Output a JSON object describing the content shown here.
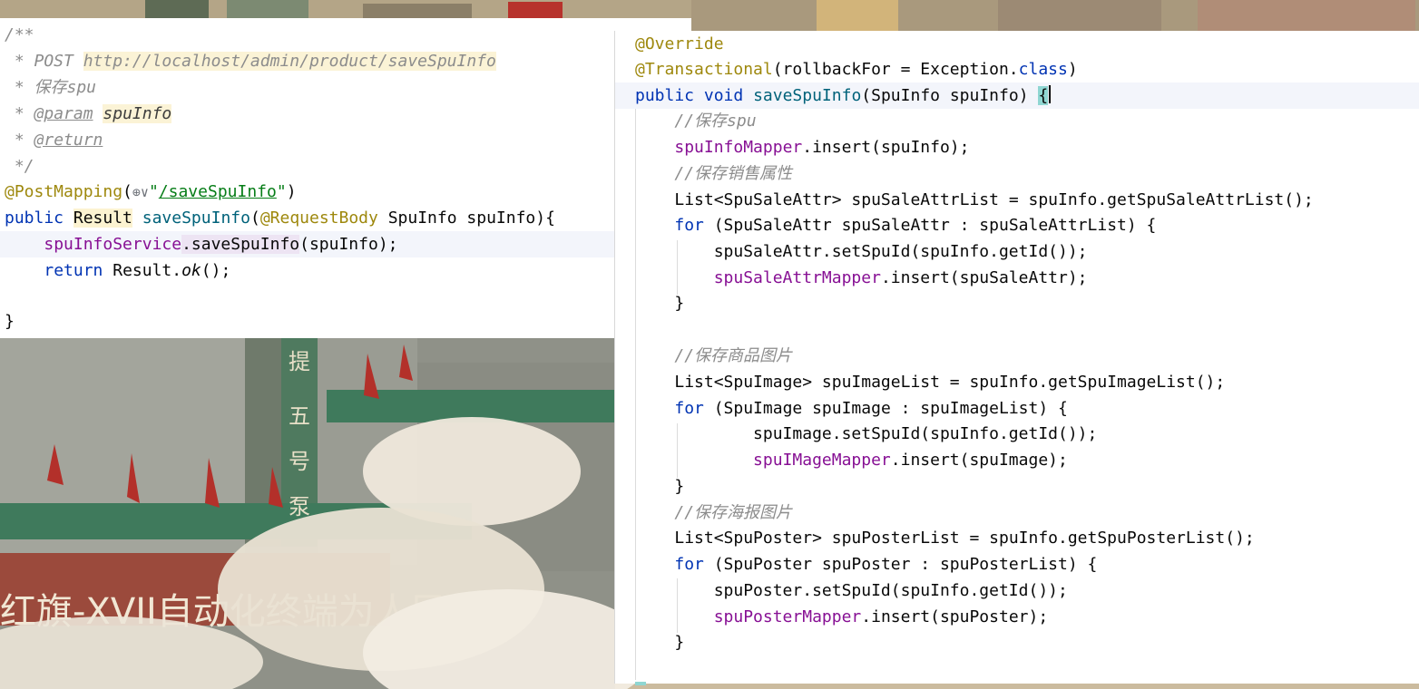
{
  "left_code": {
    "l1": "/**",
    "l2_prefix": " * POST ",
    "l2_url": "http://localhost/admin/product/saveSpuInfo",
    "l3": " * 保存spu",
    "l4_prefix": " * ",
    "l4_tag": "@param",
    "l4_name": "spuInfo",
    "l5_prefix": " * ",
    "l5_tag": "@return",
    "l6": " */",
    "l7_ann": "@PostMapping",
    "l7_open": "(",
    "l7_icon": "⊕∨",
    "l7_q1": "\"",
    "l7_path": "/saveSpuInfo",
    "l7_q2": "\"",
    "l7_close": ")",
    "l8_kw": "public",
    "l8_type": "Result",
    "l8_fn": "saveSpuInfo",
    "l8_open": "(",
    "l8_ann": "@RequestBody",
    "l8_rest": " SpuInfo spuInfo){",
    "l9_field": "spuInfoService",
    "l9_call": ".saveSpuInfo",
    "l9_rest": "(spuInfo);",
    "l10_kw": "return",
    "l10_cls": " Result.",
    "l10_fn": "ok",
    "l10_rest": "();",
    "l12": "}"
  },
  "right_code": {
    "r1": "@Override",
    "r2_ann": "@Transactional",
    "r2_rest": "(rollbackFor = Exception.",
    "r2_kw": "class",
    "r2_end": ")",
    "r3_kw1": "public",
    "r3_kw2": "void",
    "r3_fn": "saveSpuInfo",
    "r3_rest": "(SpuInfo spuInfo) ",
    "r3_brace": "{",
    "r4": "//保存spu",
    "r5_field": "spuInfoMapper",
    "r5_rest": ".insert(spuInfo);",
    "r6": "//保存销售属性",
    "r7": "List<SpuSaleAttr> spuSaleAttrList = spuInfo.getSpuSaleAttrList();",
    "r8_kw": "for",
    "r8_rest": " (SpuSaleAttr spuSaleAttr : spuSaleAttrList) {",
    "r9": "spuSaleAttr.setSpuId(spuInfo.getId());",
    "r10_field": "spuSaleAttrMapper",
    "r10_rest": ".insert(spuSaleAttr);",
    "r11": "}",
    "r13": "//保存商品图片",
    "r14": "List<SpuImage> spuImageList = spuInfo.getSpuImageList();",
    "r15_kw": "for",
    "r15_rest": " (SpuImage spuImage : spuImageList) {",
    "r16": "spuImage.setSpuId(spuInfo.getId());",
    "r17_field": "spuIMageMapper",
    "r17_rest": ".insert(spuImage);",
    "r18": "}",
    "r19": "//保存海报图片",
    "r20": "List<SpuPoster> spuPosterList = spuInfo.getSpuPosterList();",
    "r21_kw": "for",
    "r21_rest": " (SpuPoster spuPoster : spuPosterList) {",
    "r22": "spuPoster.setSpuId(spuInfo.getId());",
    "r23_field": "spuPosterMapper",
    "r23_rest": ".insert(spuPoster);",
    "r24": "}"
  },
  "wallpaper": {
    "vertical_text": [
      "提",
      "五",
      "号",
      "泵"
    ],
    "banner_text": "红旗-XVII自动化终端为人民服"
  },
  "colors": {
    "keyword": "#0033b3",
    "annotation": "#9e880d",
    "method": "#00627a",
    "field": "#871094",
    "string": "#067d17",
    "comment": "#8c8c8c"
  }
}
